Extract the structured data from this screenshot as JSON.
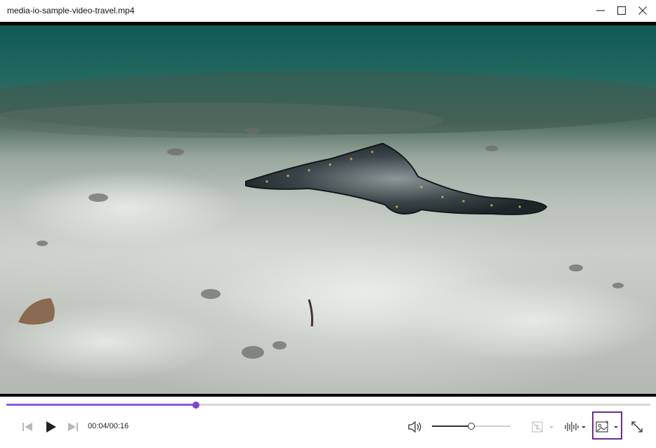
{
  "window": {
    "title": "media-io-sample-video-travel.mp4",
    "minimize_icon": "minimize-icon",
    "maximize_icon": "maximize-icon",
    "close_icon": "close-icon"
  },
  "player": {
    "time_display": "00:04/00:16",
    "progress_fraction": 0.294,
    "volume_fraction": 0.5,
    "accent_color": "#8b5bd6",
    "highlight_color": "#6f2d8e"
  },
  "controls": {
    "previous_icon": "skip-previous-icon",
    "play_icon": "play-icon",
    "next_icon": "skip-next-icon",
    "volume_icon": "speaker-icon",
    "subtitle_icon": "subtitle-icon",
    "audio_track_icon": "audio-waveform-icon",
    "snapshot_icon": "snapshot-icon",
    "fullscreen_icon": "fullscreen-icon"
  }
}
